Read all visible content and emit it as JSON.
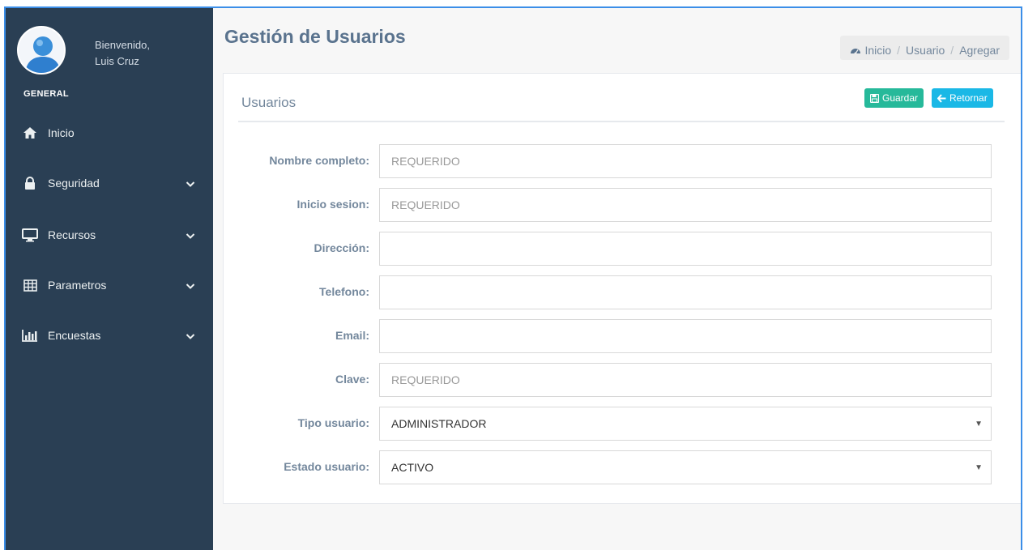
{
  "sidebar": {
    "welcome": "Bienvenido,",
    "user": "Luis Cruz",
    "role": "GENERAL",
    "items": [
      {
        "label": "Inicio",
        "icon": "home-icon"
      },
      {
        "label": "Seguridad",
        "icon": "lock-icon"
      },
      {
        "label": "Recursos",
        "icon": "monitor-icon"
      },
      {
        "label": "Parametros",
        "icon": "table-icon"
      },
      {
        "label": "Encuestas",
        "icon": "bar-chart-icon"
      }
    ]
  },
  "header": {
    "title": "Gestión de Usuarios",
    "breadcrumb": [
      "Inicio",
      "Usuario",
      "Agregar"
    ]
  },
  "panel": {
    "title": "Usuarios",
    "save_label": "Guardar",
    "back_label": "Retornar"
  },
  "form": {
    "fields": [
      {
        "label": "Nombre completo:",
        "placeholder": "REQUERIDO",
        "value": ""
      },
      {
        "label": "Inicio sesion:",
        "placeholder": "REQUERIDO",
        "value": ""
      },
      {
        "label": "Dirección:",
        "placeholder": "",
        "value": ""
      },
      {
        "label": "Telefono:",
        "placeholder": "",
        "value": ""
      },
      {
        "label": "Email:",
        "placeholder": "",
        "value": ""
      },
      {
        "label": "Clave:",
        "placeholder": "REQUERIDO",
        "value": ""
      }
    ],
    "selects": [
      {
        "label": "Tipo usuario:",
        "value": "ADMINISTRADOR"
      },
      {
        "label": "Estado usuario:",
        "value": "ACTIVO"
      }
    ]
  },
  "colors": {
    "sidebar": "#2a3f54",
    "save": "#26b99a",
    "back": "#1ab8e6",
    "frame": "#3b8ee8"
  }
}
